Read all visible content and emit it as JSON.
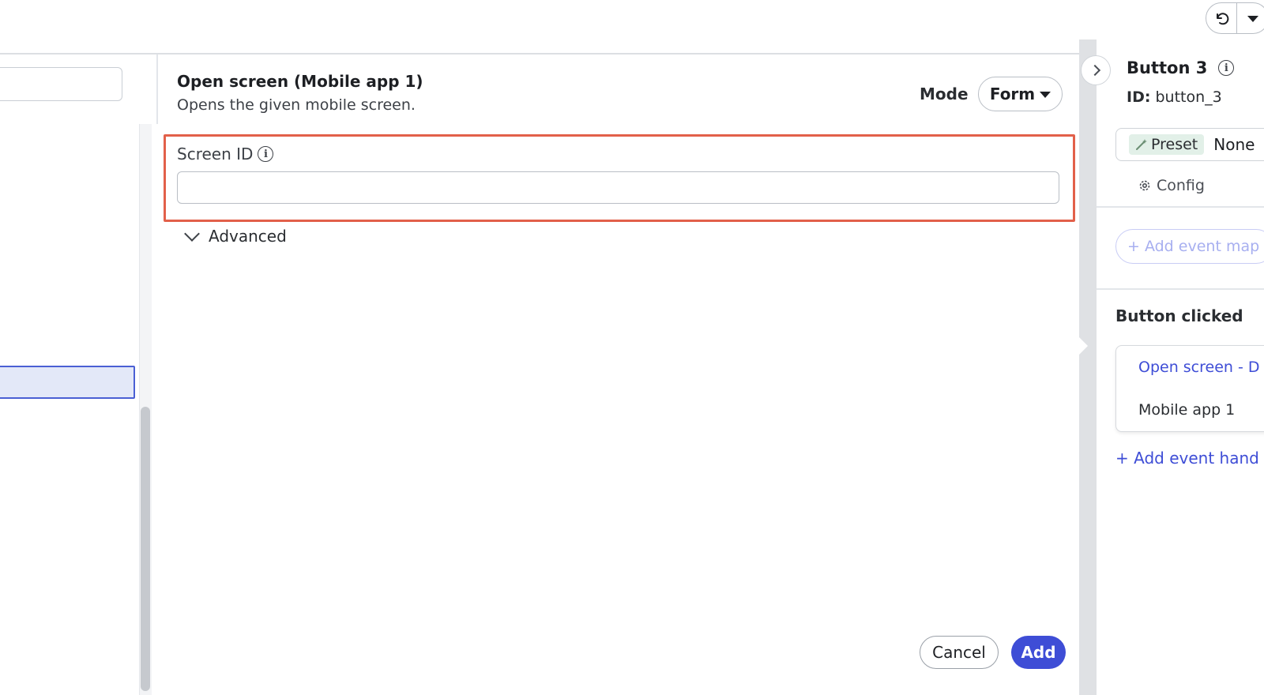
{
  "dialog": {
    "title": "Open screen (Mobile app 1)",
    "subtitle": "Opens the given mobile screen.",
    "mode_label": "Mode",
    "mode_value": "Form",
    "field": {
      "label": "Screen ID",
      "value": "",
      "placeholder": ""
    },
    "advanced_label": "Advanced",
    "cancel_label": "Cancel",
    "add_label": "Add"
  },
  "inspector": {
    "title": "Button 3",
    "id_label": "ID:",
    "id_value": "button_3",
    "preset_label": "Preset",
    "preset_value": "None",
    "config_label": "Config",
    "add_event_mapping_label": "+ Add event map",
    "section_title": "Button clicked",
    "event_card": {
      "title": "Open screen - D",
      "subtitle": "Mobile app 1"
    },
    "add_event_handler_label": "+ Add event hand"
  },
  "icons": {
    "info": "info-icon",
    "undo": "undo-icon",
    "collapse": "chevron-right-icon",
    "advanced": "chevron-down-icon",
    "preset": "wand-icon",
    "config": "gear-icon"
  },
  "colors": {
    "accent": "#3e4dd6",
    "highlight": "#e2604a",
    "selection": "#e3e8f8",
    "preset_chip": "#e2f0e8"
  }
}
